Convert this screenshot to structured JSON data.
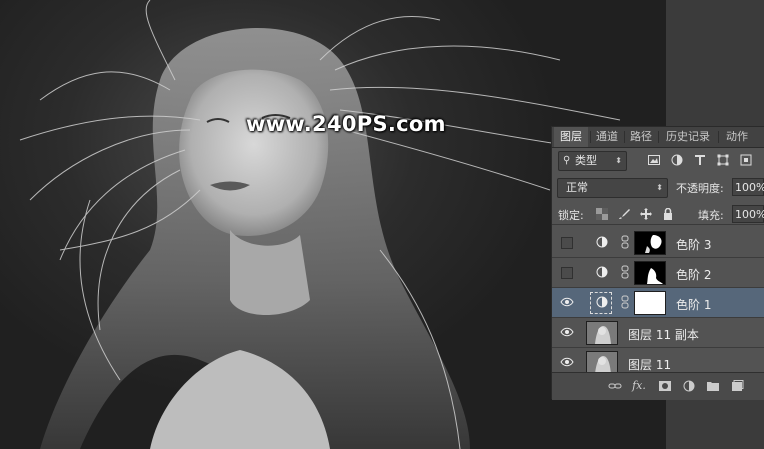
{
  "watermark": "www.240PS.com",
  "panel": {
    "tabs": [
      "图层",
      "通道",
      "路径",
      "历史记录",
      "动作"
    ],
    "filter_label": "类型",
    "blend_mode": "正常",
    "opacity_label": "不透明度:",
    "opacity_value": "100%",
    "lock_label": "锁定:",
    "fill_label": "填充:",
    "fill_value": "100%",
    "layers": [
      {
        "name": "色阶 3",
        "visible": false,
        "selected": false,
        "type": "adjustment"
      },
      {
        "name": "色阶 2",
        "visible": false,
        "selected": false,
        "type": "adjustment"
      },
      {
        "name": "色阶 1",
        "visible": true,
        "selected": true,
        "type": "adjustment"
      },
      {
        "name": "图层 11 副本",
        "visible": true,
        "selected": false,
        "type": "pixel"
      },
      {
        "name": "图层 11",
        "visible": true,
        "selected": false,
        "type": "pixel"
      }
    ],
    "bottom_icons": [
      "link-icon",
      "fx-icon",
      "mask-icon",
      "adjustment-icon",
      "folder-icon",
      "new-layer-icon"
    ]
  },
  "colors": {
    "panel_bg": "#535353",
    "selected_row": "#56677a",
    "tab_bar": "#424242"
  }
}
